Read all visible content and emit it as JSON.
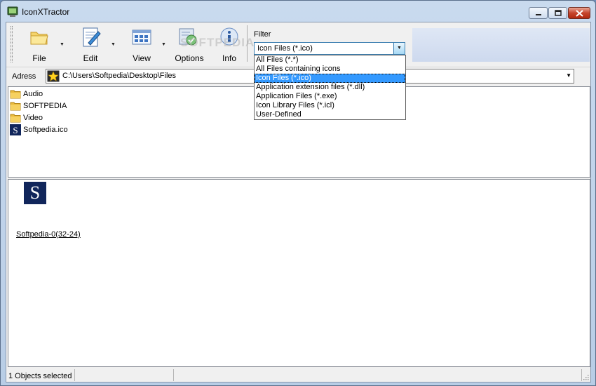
{
  "window": {
    "title": "IconXTractor"
  },
  "toolbar": {
    "file_label": "File",
    "edit_label": "Edit",
    "view_label": "View",
    "options_label": "Options",
    "info_label": "Info"
  },
  "filter": {
    "label": "Filter",
    "selected": "Icon Files (*.ico)",
    "options": [
      "All Files (*.*)",
      "All Files containing icons",
      "Icon Files (*.ico)",
      "Application extension files (*.dll)",
      "Application Files (*.exe)",
      "Icon Library Files (*.icl)",
      "User-Defined"
    ]
  },
  "address": {
    "label": "Adress",
    "value": "C:\\Users\\Softpedia\\Desktop\\Files"
  },
  "files": [
    {
      "name": "Audio",
      "type": "folder"
    },
    {
      "name": "SOFTPEDIA",
      "type": "folder"
    },
    {
      "name": "Video",
      "type": "folder"
    },
    {
      "name": "Softpedia.ico",
      "type": "ico"
    }
  ],
  "preview": {
    "icon_glyph": "S",
    "icon_label": "Softpedia-0(32-24)"
  },
  "status": {
    "text": "1 Objects selected"
  },
  "watermark": "SOFTPEDIA",
  "colors": {
    "selection": "#3399ff",
    "icon_bg": "#11265b",
    "folder": "#e8b83a"
  }
}
